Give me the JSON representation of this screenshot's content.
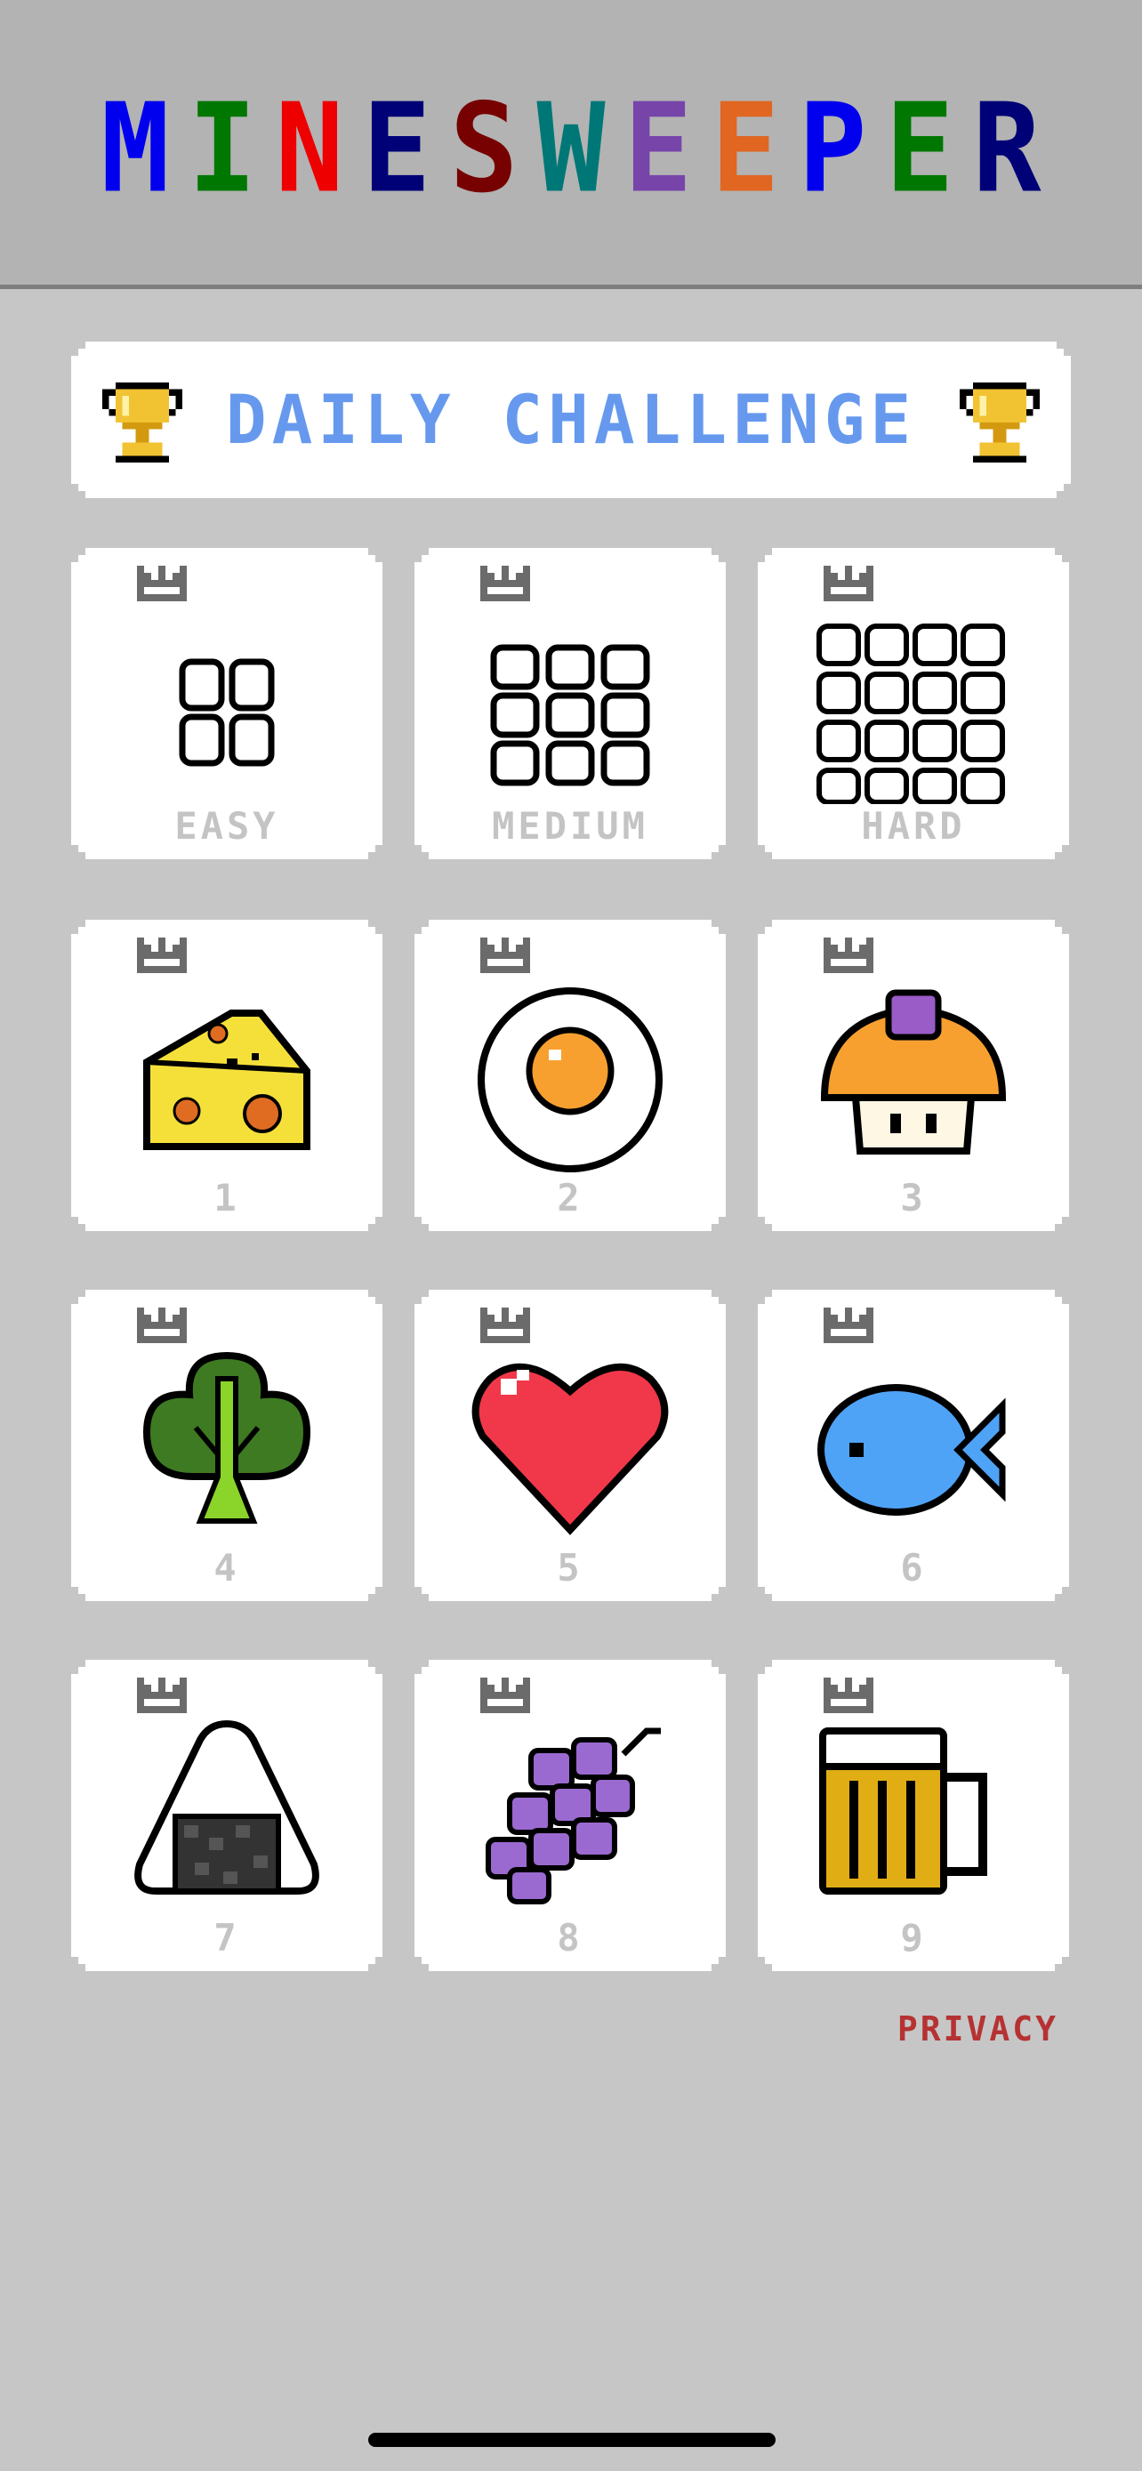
{
  "app": {
    "title_letters": [
      {
        "ch": "M",
        "color": "#0000ee"
      },
      {
        "ch": "I",
        "color": "#007700"
      },
      {
        "ch": "N",
        "color": "#ee0000"
      },
      {
        "ch": "E",
        "color": "#000077"
      },
      {
        "ch": "S",
        "color": "#770000"
      },
      {
        "ch": "W",
        "color": "#007777"
      },
      {
        "ch": "E",
        "color": "#7744aa"
      },
      {
        "ch": "E",
        "color": "#e06622"
      },
      {
        "ch": "P",
        "color": "#0000ee"
      },
      {
        "ch": "E",
        "color": "#007700"
      },
      {
        "ch": "R",
        "color": "#000077"
      }
    ]
  },
  "daily_challenge": {
    "label": "DAILY CHALLENGE",
    "icon": "trophy-icon"
  },
  "difficulty_cards": [
    {
      "label": "EASY",
      "icon": "grid-2x2-icon"
    },
    {
      "label": "MEDIUM",
      "icon": "grid-3x3-icon"
    },
    {
      "label": "HARD",
      "icon": "grid-4x4-icon"
    }
  ],
  "level_cards": [
    {
      "label": "1",
      "icon": "cheese-icon"
    },
    {
      "label": "2",
      "icon": "fried-egg-icon"
    },
    {
      "label": "3",
      "icon": "mushroom-icon"
    },
    {
      "label": "4",
      "icon": "broccoli-icon"
    },
    {
      "label": "5",
      "icon": "heart-icon"
    },
    {
      "label": "6",
      "icon": "fish-icon"
    },
    {
      "label": "7",
      "icon": "onigiri-icon"
    },
    {
      "label": "8",
      "icon": "grapes-icon"
    },
    {
      "label": "9",
      "icon": "beer-mug-icon"
    }
  ],
  "footer": {
    "privacy_label": "PRIVACY"
  },
  "colors": {
    "background": "#c6c6c6",
    "header": "#b3b3b3",
    "daily_text": "#6699ee",
    "card_label": "#c4c4c4",
    "privacy": "#b63232"
  }
}
